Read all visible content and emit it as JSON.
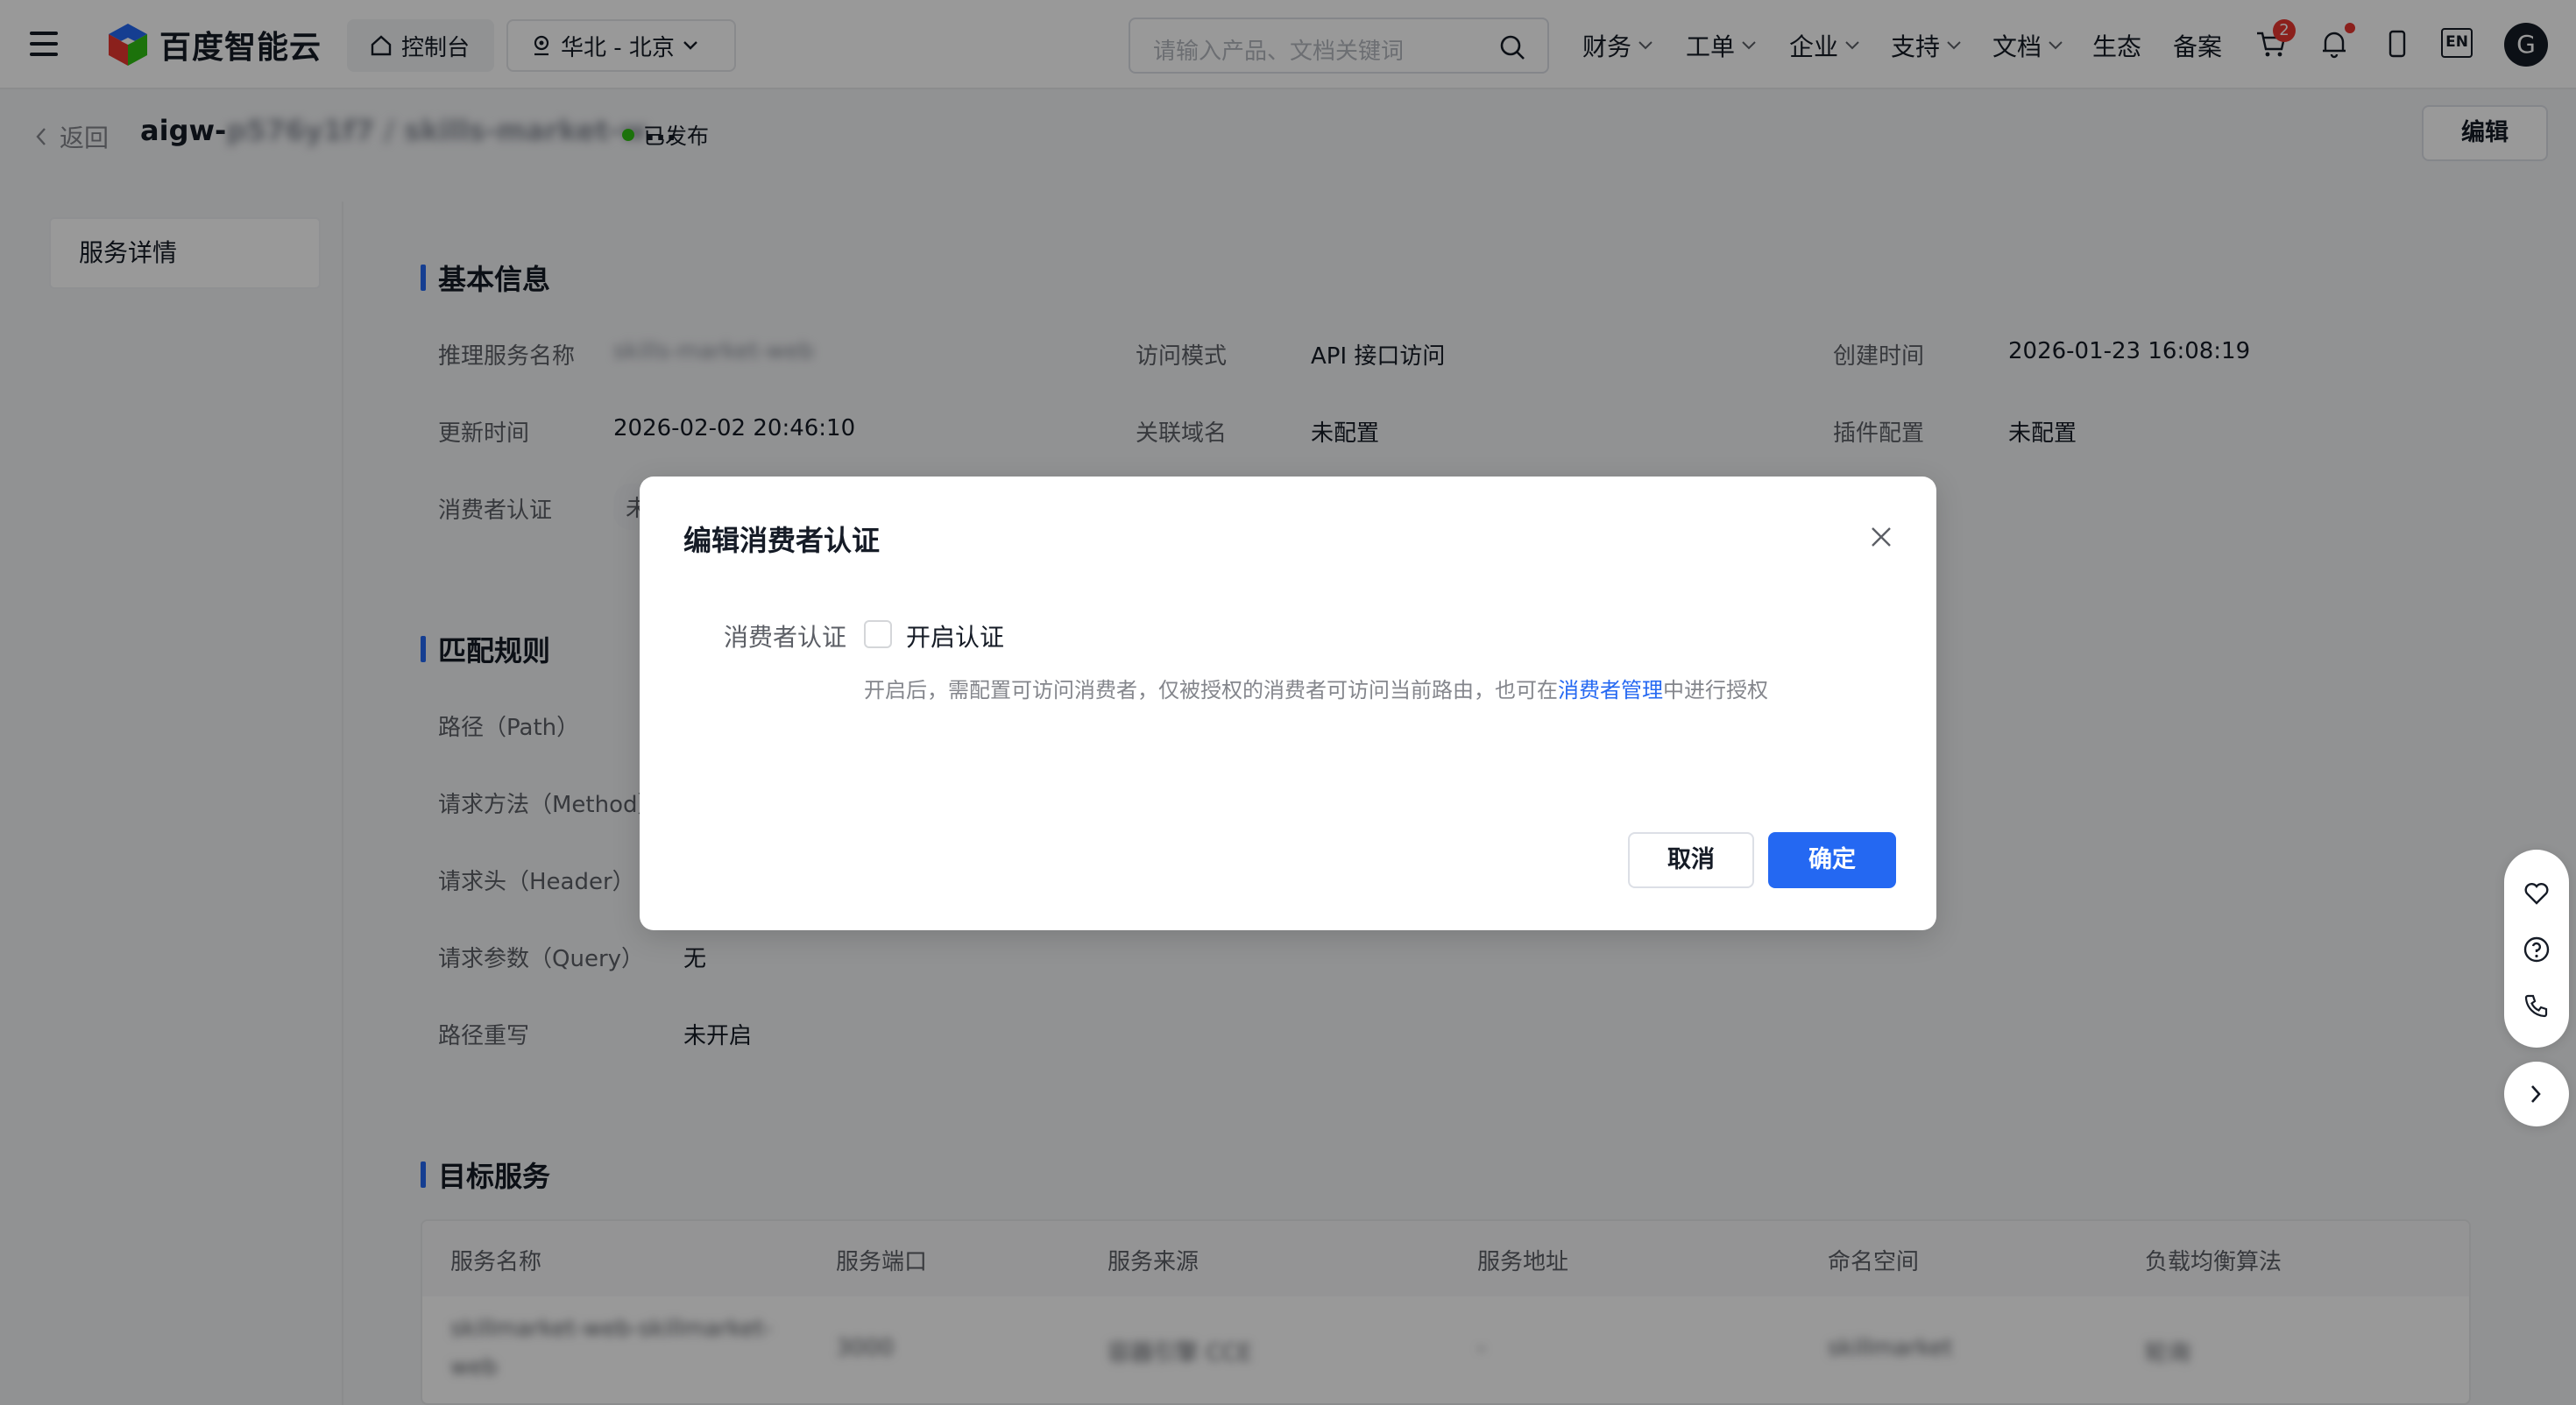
{
  "nav": {
    "logo_text": "百度智能云",
    "console": "控制台",
    "region": "华北 - 北京",
    "search_placeholder": "请输入产品、文档关键词",
    "items": [
      {
        "label": "财务",
        "has_dropdown": true
      },
      {
        "label": "工单",
        "has_dropdown": true
      },
      {
        "label": "企业",
        "has_dropdown": true
      },
      {
        "label": "支持",
        "has_dropdown": true
      },
      {
        "label": "文档",
        "has_dropdown": true
      },
      {
        "label": "生态",
        "has_dropdown": false
      },
      {
        "label": "备案",
        "has_dropdown": false
      }
    ],
    "cart_badge": "2",
    "lang": "EN",
    "avatar": "G"
  },
  "header": {
    "back_label": "返回",
    "title_prefix": "aigw-",
    "title_blurred": "p576y1f7 / skills-market-w",
    "title_suffix": "...",
    "status": "已发布",
    "edit_button": "编辑"
  },
  "sidebar": {
    "items": [
      {
        "label": "服务详情"
      }
    ]
  },
  "basic": {
    "title": "基本信息",
    "rows": [
      {
        "label": "推理服务名称",
        "value": "skills-market-web",
        "blurred": true
      },
      {
        "label": "访问模式",
        "value": "API 接口访问"
      },
      {
        "label": "创建时间",
        "value": "2026-01-23 16:08:19"
      },
      {
        "label": "更新时间",
        "value": "2026-02-02 20:46:10"
      },
      {
        "label": "关联域名",
        "value": "未配置"
      },
      {
        "label": "插件配置",
        "value": "未配置"
      },
      {
        "label": "消费者认证",
        "value": "未"
      }
    ]
  },
  "match": {
    "title": "匹配规则",
    "rows": [
      {
        "label": "路径（Path）",
        "value": ""
      },
      {
        "label": "请求方法（Method）",
        "value": ""
      },
      {
        "label": "请求头（Header）",
        "value": ""
      },
      {
        "label": "请求参数（Query）",
        "value": "无"
      },
      {
        "label": "路径重写",
        "value": "未开启"
      }
    ]
  },
  "target": {
    "title": "目标服务",
    "columns": [
      "服务名称",
      "服务端口",
      "服务来源",
      "服务地址",
      "命名空间",
      "负载均衡算法"
    ],
    "row": [
      "skillmarket-web-skillmarket-",
      "web",
      "3000",
      "容器引擎 CCE",
      "-",
      "skillmarket",
      "轮询"
    ]
  },
  "modal": {
    "title": "编辑消费者认证",
    "field_label": "消费者认证",
    "checkbox_label": "开启认证",
    "checked": false,
    "hint_before": "开启后，需配置可访问消费者，仅被授权的消费者可访问当前路由，也可在",
    "hint_link": "消费者管理",
    "hint_after": "中进行授权",
    "cancel": "取消",
    "ok": "确定"
  },
  "colors": {
    "primary": "#2468f2",
    "status_green": "#30bf13",
    "badge_red": "#e8362f"
  }
}
